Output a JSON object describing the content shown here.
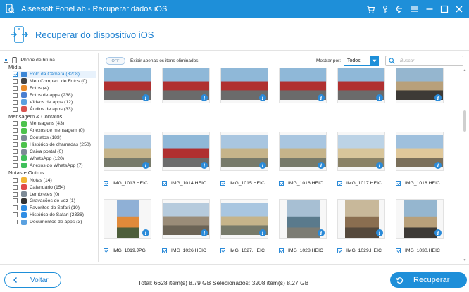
{
  "window": {
    "title": "Aiseesoft FoneLab - Recuperar dados iOS"
  },
  "header": {
    "title": "Recuperar do dispositivo iOS"
  },
  "sidebar": {
    "device": "iPhone de bruna",
    "groups": [
      {
        "title": "Mídia",
        "items": [
          {
            "label": "Rolo da Câmera (3208)",
            "icon_color": "#3b86d6",
            "state": "checked",
            "selected": true
          },
          {
            "label": "Meu Compart. de Fotos (0)",
            "icon_color": "#444444",
            "state": "empty"
          },
          {
            "label": "Fotos (4)",
            "icon_color": "#e88a2a",
            "state": "empty"
          },
          {
            "label": "Fotos de apps (238)",
            "icon_color": "#4a7fd0",
            "state": "empty"
          },
          {
            "label": "Vídeos de apps (12)",
            "icon_color": "#5aa1e0",
            "state": "empty"
          },
          {
            "label": "Áudios de apps (33)",
            "icon_color": "#d9534f",
            "state": "empty"
          }
        ]
      },
      {
        "title": "Mensagem & Contatos",
        "items": [
          {
            "label": "Mensagens (43)",
            "icon_color": "#4cc24c",
            "state": "empty"
          },
          {
            "label": "Anexos de mensagem (0)",
            "icon_color": "#4cc24c",
            "state": "empty"
          },
          {
            "label": "Contatos (183)",
            "icon_color": "#7d8a96",
            "state": "empty"
          },
          {
            "label": "Histórico de chamadas (250)",
            "icon_color": "#4cc24c",
            "state": "empty"
          },
          {
            "label": "Caixa postal (0)",
            "icon_color": "#7d8a96",
            "state": "empty"
          },
          {
            "label": "WhatsApp (120)",
            "icon_color": "#3fbf5b",
            "state": "empty"
          },
          {
            "label": "Anexos do WhatsApp (7)",
            "icon_color": "#3fbf5b",
            "state": "empty"
          }
        ]
      },
      {
        "title": "Notas e Outros",
        "items": [
          {
            "label": "Notas (14)",
            "icon_color": "#f2b534",
            "state": "empty"
          },
          {
            "label": "Calendário (154)",
            "icon_color": "#e04a4a",
            "state": "empty"
          },
          {
            "label": "Lembretes (0)",
            "icon_color": "#7d8a96",
            "state": "empty"
          },
          {
            "label": "Gravações de voz (1)",
            "icon_color": "#333333",
            "state": "empty"
          },
          {
            "label": "Favoritos do Safari (10)",
            "icon_color": "#2f8de4",
            "state": "empty"
          },
          {
            "label": "Histórico do Safari (2336)",
            "icon_color": "#2f8de4",
            "state": "empty"
          },
          {
            "label": "Documentos de apps (3)",
            "icon_color": "#5aa1e0",
            "state": "empty"
          }
        ]
      }
    ]
  },
  "toolbar": {
    "toggle_label": "OFF",
    "only_deleted_label": "Exibir apenas os itens eliminados",
    "show_label": "Mostrar por:",
    "show_value": "Todos",
    "search_placeholder": "Buscar"
  },
  "grid": {
    "items": [
      {
        "name": "",
        "checked": true,
        "scene": "car"
      },
      {
        "name": "",
        "checked": true,
        "scene": "car"
      },
      {
        "name": "",
        "checked": true,
        "scene": "car"
      },
      {
        "name": "",
        "checked": true,
        "scene": "car"
      },
      {
        "name": "",
        "checked": true,
        "scene": "car"
      },
      {
        "name": "",
        "checked": true,
        "scene": "person"
      },
      {
        "name": "IMG_1013.HEIC",
        "checked": true,
        "scene": "street"
      },
      {
        "name": "IMG_1014.HEIC",
        "checked": true,
        "scene": "car"
      },
      {
        "name": "IMG_1015.HEIC",
        "checked": true,
        "scene": "street"
      },
      {
        "name": "IMG_1016.HEIC",
        "checked": true,
        "scene": "street"
      },
      {
        "name": "IMG_1017.HEIC",
        "checked": true,
        "scene": "square"
      },
      {
        "name": "IMG_1018.HEIC",
        "checked": true,
        "scene": "building"
      },
      {
        "name": "IMG_1019.JPG",
        "checked": true,
        "scene": "portrait"
      },
      {
        "name": "IMG_1026.HEIC",
        "checked": true,
        "scene": "arch"
      },
      {
        "name": "IMG_1027.HEIC",
        "checked": true,
        "scene": "street"
      },
      {
        "name": "IMG_1028.HEIC",
        "checked": true,
        "scene": "bus"
      },
      {
        "name": "IMG_1029.HEIC",
        "checked": true,
        "scene": "market"
      },
      {
        "name": "IMG_1030.HEIC",
        "checked": true,
        "scene": "person"
      }
    ]
  },
  "footer": {
    "back_label": "Voltar",
    "totals_text": "Total: 6628 item(s) 8.79 GB Selecionados: 3208 item(s) 8.27 GB",
    "recover_label": "Recuperar"
  }
}
